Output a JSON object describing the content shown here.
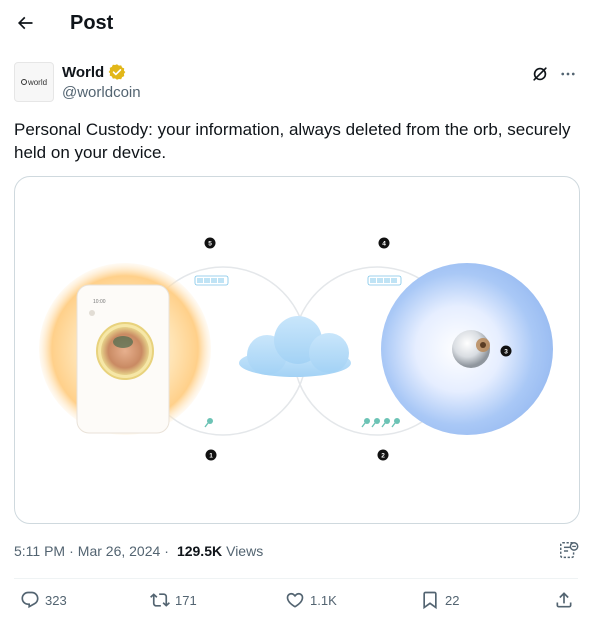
{
  "header": {
    "title": "Post"
  },
  "author": {
    "display_name": "World",
    "handle": "@worldcoin",
    "avatar_text": "world"
  },
  "post": {
    "text": "Personal Custody: your information, always deleted from the orb, securely held on your device."
  },
  "media": {
    "phone_time": "10:00",
    "step_labels": [
      "1",
      "2",
      "3",
      "4",
      "5"
    ]
  },
  "meta": {
    "time": "5:11 PM",
    "date": "Mar 26, 2024",
    "views_count": "129.5K",
    "views_label": "Views"
  },
  "actions": {
    "replies": "323",
    "reposts": "171",
    "likes": "1.1K",
    "bookmarks": "22"
  },
  "icons": [
    "back-arrow-icon",
    "verified-badge-icon",
    "grok-icon",
    "more-icon",
    "analytics-icon",
    "reply-icon",
    "repost-icon",
    "like-icon",
    "bookmark-icon",
    "share-icon"
  ],
  "colors": {
    "verified_gold": "#e2b719",
    "muted": "#536471",
    "text": "#0f1419",
    "border": "#cfd9de"
  }
}
